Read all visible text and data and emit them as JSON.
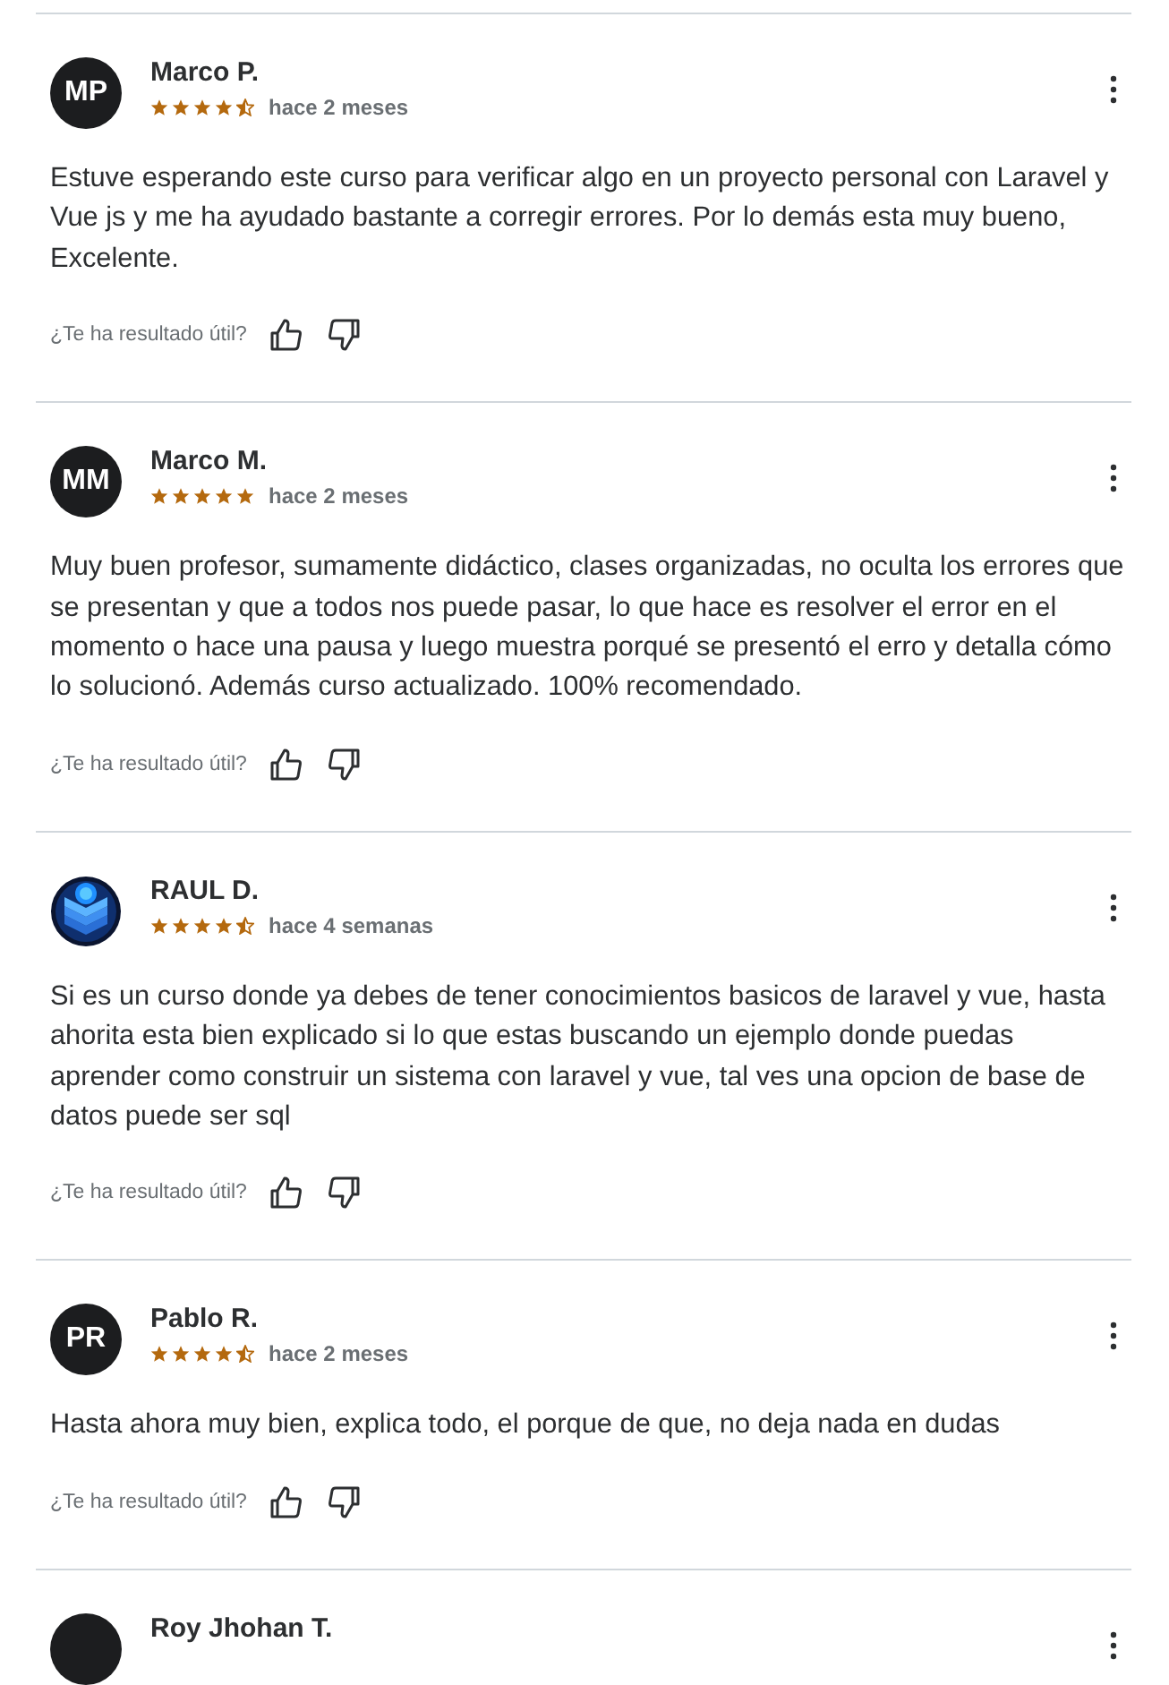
{
  "reviews": [
    {
      "avatar": {
        "kind": "initials",
        "initials": "MP"
      },
      "name": "Marco P.",
      "stars": 4.5,
      "date": "hace 2 meses",
      "body": "Estuve esperando este curso para verificar algo en un proyecto personal con Laravel y Vue js y me ha ayudado bastante a corregir errores. Por lo demás esta muy bueno, Excelente.",
      "helpful_prompt": "¿Te ha resultado útil?"
    },
    {
      "avatar": {
        "kind": "initials",
        "initials": "MM"
      },
      "name": "Marco M.",
      "stars": 5,
      "date": "hace 2 meses",
      "body": "Muy buen profesor, sumamente didáctico, clases organizadas, no oculta los errores que se presentan y que a todos nos puede pasar, lo que hace es resolver el error en el momento o hace una pausa y luego muestra porqué se presentó el erro y detalla cómo lo solucionó. Además curso actualizado. 100% recomendado.",
      "helpful_prompt": "¿Te ha resultado útil?"
    },
    {
      "name": "RAUL D.",
      "stars": 4.5,
      "date": "hace 4 semanas",
      "body": "Si es un curso donde ya debes de tener conocimientos basicos de laravel y vue, hasta ahorita esta bien explicado si lo que estas buscando un ejemplo donde puedas aprender como construir un sistema con laravel y vue, tal ves una opcion de base de datos puede ser sql",
      "helpful_prompt": "¿Te ha resultado útil?"
    },
    {
      "avatar": {
        "kind": "initials",
        "initials": "PR"
      },
      "name": "Pablo R.",
      "stars": 4.5,
      "date": "hace 2 meses",
      "body": "Hasta ahora muy bien, explica todo, el porque de que, no deja nada en dudas",
      "helpful_prompt": "¿Te ha resultado útil?"
    },
    {
      "avatar": {
        "kind": "initials"
      },
      "name": "Roy Jhohan T."
    }
  ]
}
